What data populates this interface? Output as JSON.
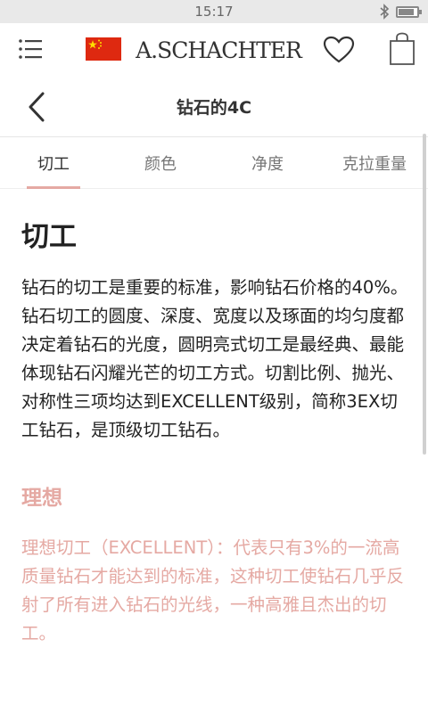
{
  "status_bar": {
    "time": "15:17",
    "battery_level": 0.85
  },
  "header": {
    "logo_text": "A.SCHACHTER"
  },
  "page": {
    "title": "钻石的4C"
  },
  "tabs": [
    {
      "label": "切工",
      "active": true
    },
    {
      "label": "颜色",
      "active": false
    },
    {
      "label": "净度",
      "active": false
    },
    {
      "label": "克拉重量",
      "active": false
    }
  ],
  "section": {
    "heading": "切工",
    "body": "钻石的切工是重要的标准，影响钻石价格的40%。钻石切工的圆度、深度、宽度以及琢面的均匀度都决定着钻石的光度，圆明亮式切工是最经典、最能体现钻石闪耀光芒的切工方式。切割比例、抛光、对称性三项均达到EXCELLENT级别，简称3EX切工钻石，是顶级切工钻石。",
    "ideal_heading": "理想",
    "ideal_body": "理想切工（EXCELLENT）：代表只有3%的一流高质量钻石才能达到的标准，这种切工使钻石几乎反射了所有进入钻石的光线，一种高雅且杰出的切工。"
  },
  "colors": {
    "accent": "#e5a9a3",
    "flag_red": "#de2910",
    "flag_yellow": "#ffde00"
  },
  "icons": {
    "menu": "menu-icon",
    "flag": "china-flag-icon",
    "heart": "heart-icon",
    "bag": "shopping-bag-icon",
    "back": "back-arrow-icon",
    "bluetooth": "bluetooth-icon",
    "battery": "battery-icon"
  }
}
